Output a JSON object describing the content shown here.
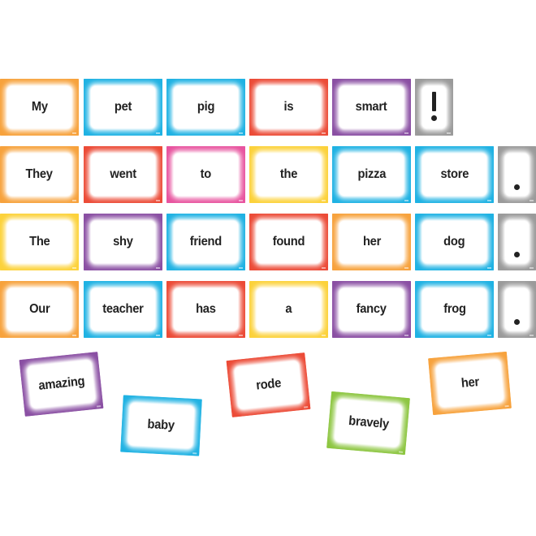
{
  "colors": {
    "orange": "#f7a23c",
    "blue": "#1fb2e3",
    "red": "#ec4b37",
    "purple": "#8a4fa3",
    "gray": "#9a9a9a",
    "pink": "#e8549f",
    "yellow": "#fcd23a",
    "green": "#8dc641"
  },
  "rows": [
    {
      "words": [
        {
          "text": "My",
          "color": "orange"
        },
        {
          "text": "pet",
          "color": "blue"
        },
        {
          "text": "pig",
          "color": "blue"
        },
        {
          "text": "is",
          "color": "red"
        },
        {
          "text": "smart",
          "color": "purple"
        }
      ],
      "punctuation": {
        "symbol": "!",
        "name": "exclamation-mark",
        "color": "gray"
      }
    },
    {
      "words": [
        {
          "text": "They",
          "color": "orange"
        },
        {
          "text": "went",
          "color": "red"
        },
        {
          "text": "to",
          "color": "pink"
        },
        {
          "text": "the",
          "color": "yellow"
        },
        {
          "text": "pizza",
          "color": "blue"
        },
        {
          "text": "store",
          "color": "blue"
        }
      ],
      "punctuation": {
        "symbol": ".",
        "name": "period",
        "color": "gray"
      }
    },
    {
      "words": [
        {
          "text": "The",
          "color": "yellow"
        },
        {
          "text": "shy",
          "color": "purple"
        },
        {
          "text": "friend",
          "color": "blue"
        },
        {
          "text": "found",
          "color": "red"
        },
        {
          "text": "her",
          "color": "orange"
        },
        {
          "text": "dog",
          "color": "blue"
        }
      ],
      "punctuation": {
        "symbol": ".",
        "name": "period",
        "color": "gray"
      }
    },
    {
      "words": [
        {
          "text": "Our",
          "color": "orange"
        },
        {
          "text": "teacher",
          "color": "blue"
        },
        {
          "text": "has",
          "color": "red"
        },
        {
          "text": "a",
          "color": "yellow"
        },
        {
          "text": "fancy",
          "color": "purple"
        },
        {
          "text": "frog",
          "color": "blue"
        }
      ],
      "punctuation": {
        "symbol": ".",
        "name": "period",
        "color": "gray"
      }
    }
  ],
  "loose_cards": [
    {
      "text": "amazing",
      "color": "purple"
    },
    {
      "text": "baby",
      "color": "blue"
    },
    {
      "text": "rode",
      "color": "red"
    },
    {
      "text": "bravely",
      "color": "green"
    },
    {
      "text": "her",
      "color": "orange"
    }
  ]
}
